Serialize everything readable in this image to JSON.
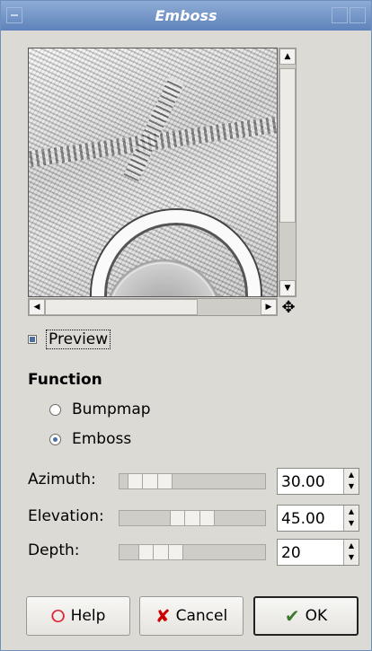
{
  "window": {
    "title": "Emboss"
  },
  "preview": {
    "checkbox_label": "Preview",
    "checked": true
  },
  "function": {
    "heading": "Function",
    "options": [
      {
        "label": "Bumpmap",
        "selected": false
      },
      {
        "label": "Emboss",
        "selected": true
      }
    ]
  },
  "params": [
    {
      "label": "Azimuth:",
      "value": "30.00",
      "level": 0.08
    },
    {
      "label": "Elevation:",
      "value": "45.00",
      "level": 0.5
    },
    {
      "label": "Depth:",
      "value": "20",
      "level": 0.19
    }
  ],
  "buttons": {
    "help": "Help",
    "cancel": "Cancel",
    "ok": "OK"
  },
  "colors": {
    "titlebar": "#6f8fbd",
    "accent": "#4a6fa5",
    "background": "#dcdad5"
  },
  "icons": {
    "help": "lifebuoy-icon",
    "cancel": "x-icon",
    "ok": "check-icon",
    "navigate": "move-icon"
  }
}
